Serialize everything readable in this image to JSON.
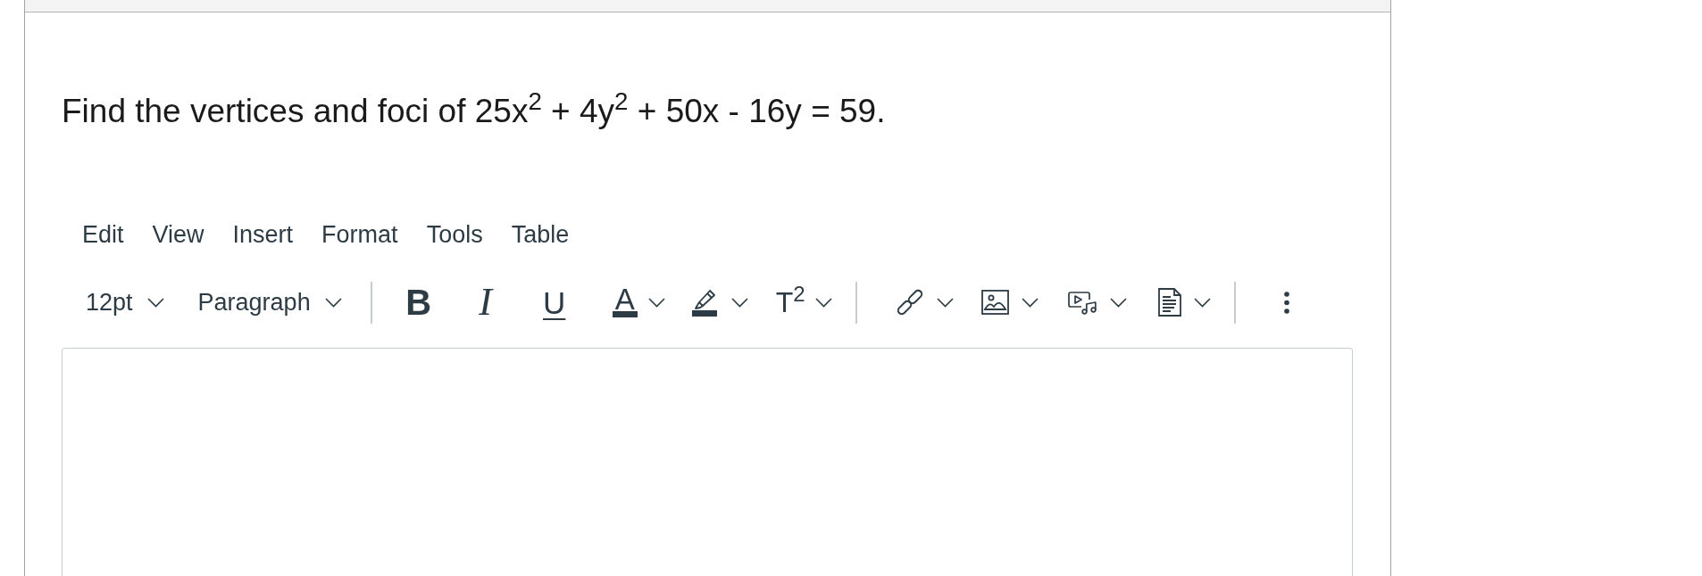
{
  "question": {
    "text": "Find the vertices and foci of 25x$^{2}$ + 4y$^{2}$ + 50x - 16y = 59."
  },
  "editor": {
    "menubar": [
      {
        "label": "Edit"
      },
      {
        "label": "View"
      },
      {
        "label": "Insert"
      },
      {
        "label": "Format"
      },
      {
        "label": "Tools"
      },
      {
        "label": "Table"
      }
    ],
    "toolbar": [
      {
        "kind": "font_size_menu",
        "label": "12pt"
      },
      {
        "kind": "block_format_menu",
        "label": "Paragraph"
      },
      {
        "kind": "separator"
      },
      {
        "kind": "bold",
        "label": "B"
      },
      {
        "kind": "italic",
        "label": "I"
      },
      {
        "kind": "underline",
        "label": "U"
      },
      {
        "kind": "text_color",
        "label": "A"
      },
      {
        "kind": "highlight"
      },
      {
        "kind": "superscript",
        "label": "T$^{2}$"
      },
      {
        "kind": "separator"
      },
      {
        "kind": "link"
      },
      {
        "kind": "image"
      },
      {
        "kind": "media"
      },
      {
        "kind": "document"
      },
      {
        "kind": "separator"
      },
      {
        "kind": "more"
      }
    ]
  }
}
